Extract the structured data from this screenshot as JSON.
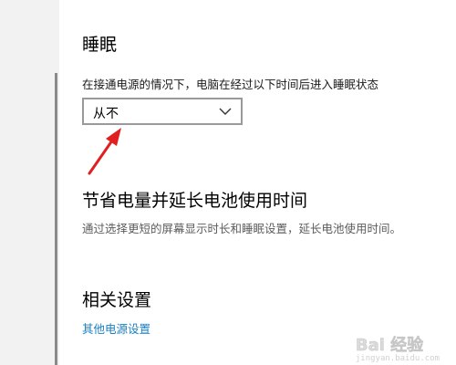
{
  "sleep": {
    "title": "睡眠",
    "description": "在接通电源的情况下，电脑在经过以下时间后进入睡眠状态",
    "dropdown_value": "从不"
  },
  "battery": {
    "title": "节省电量并延长电池使用时间",
    "description": "通过选择更短的屏幕显示时长和睡眠设置，延长电池使用时间。"
  },
  "related": {
    "title": "相关设置",
    "link": "其他电源设置"
  },
  "watermark": {
    "brand": "Bai 经验",
    "url": "jingyan.baidu.com"
  },
  "colors": {
    "link": "#1a7fc1",
    "annotation_arrow": "#e02020"
  }
}
